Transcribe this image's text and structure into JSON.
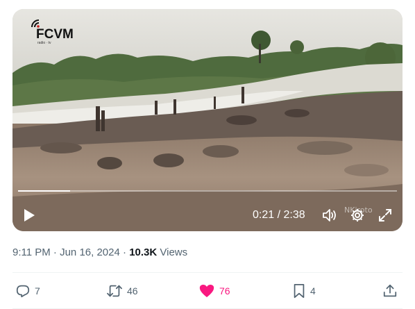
{
  "video": {
    "logo_text": "FCVM",
    "logo_subtext": "radio · tv",
    "watermark": "NKiroto",
    "progress_fraction": 0.137,
    "time_display": "0:21 / 2:38",
    "icons": {
      "play": "play-icon",
      "volume": "volume-icon",
      "settings": "gear-icon",
      "fullscreen": "fullscreen-icon"
    }
  },
  "tweet_meta": {
    "time": "9:11 PM",
    "separator": "·",
    "date": "Jun 16, 2024",
    "views_count": "10.3K",
    "views_label": "Views"
  },
  "actions": {
    "reply": {
      "count": "7",
      "icon": "reply-icon"
    },
    "retweet": {
      "count": "46",
      "icon": "retweet-icon"
    },
    "like": {
      "count": "76",
      "icon": "heart-icon",
      "color": "#f91880"
    },
    "bookmark": {
      "count": "4",
      "icon": "bookmark-icon"
    },
    "share": {
      "icon": "share-icon"
    }
  },
  "colors": {
    "text_primary": "#0f1419",
    "text_secondary": "#536471",
    "like_active": "#f91880",
    "divider": "#eff3f4"
  }
}
